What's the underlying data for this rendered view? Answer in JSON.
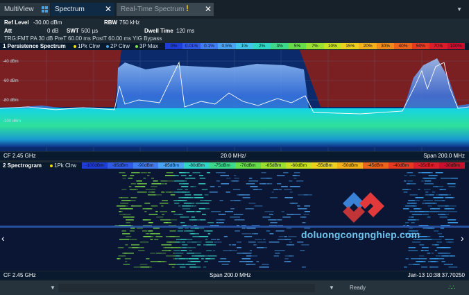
{
  "tabs": {
    "multiview": "MultiView",
    "spectrum": "Spectrum",
    "realtime": "Real-Time Spectrum",
    "warning_icon": "warning-icon"
  },
  "settings": {
    "ref_level_label": "Ref Level",
    "ref_level_value": "-30.00 dBm",
    "att_label": "Att",
    "att_value": "0 dB",
    "rbw_label": "RBW",
    "rbw_value": "750 kHz",
    "swt_label": "SWT",
    "swt_value": "500 µs",
    "dwell_label": "Dwell Time",
    "dwell_value": "120 ms",
    "trigger_line": "TRG:FMT  PA 30 dB  PreT 60.00 ms    PostT 60.00 ms   YIG Bypass"
  },
  "persistence": {
    "title": "1 Persistence Spectrum",
    "legend": [
      "1Pk Clrw",
      "2P Clrw",
      "3P Max"
    ],
    "legend_colors": [
      "#f5e000",
      "#4aa3e0",
      "#7fe04a"
    ],
    "scale": [
      "0%",
      "0.01%",
      "0.1%",
      "0.5%",
      "1%",
      "2%",
      "3%",
      "5%",
      "7%",
      "10%",
      "15%",
      "20%",
      "30%",
      "40%",
      "50%",
      "70%",
      "100%"
    ],
    "ylabels": [
      "-40 dBm",
      "-60 dBm",
      "-80 dBm",
      "-100 dBm"
    ],
    "footer_left": "CF 2.45 GHz",
    "footer_center": "20.0 MHz/",
    "footer_right": "Span 200.0 MHz"
  },
  "spectrogram": {
    "title": "2 Spectrogram",
    "legend": [
      "1Pk Clrw"
    ],
    "scale": [
      "-100dBm",
      "-95dBm",
      "-90dBm",
      "-85dBm",
      "-80dBm",
      "-75dBm",
      "-70dBm",
      "-65dBm",
      "-60dBm",
      "-55dBm",
      "-50dBm",
      "-45dBm",
      "-40dBm",
      "-35dBm",
      "-30dBm"
    ],
    "footer_left": "CF 2.45 GHz",
    "footer_center": "Span 200.0 MHz",
    "footer_right": "Jan-13 10:38:37.70250"
  },
  "status": {
    "ready": "Ready"
  },
  "watermark": "doluongcongnghiep.com",
  "colors": {
    "accent": "#4aa3e0",
    "warning": "#f2d200",
    "spectrum_bg": "#0b2a6b",
    "trace": "#ffffff"
  }
}
